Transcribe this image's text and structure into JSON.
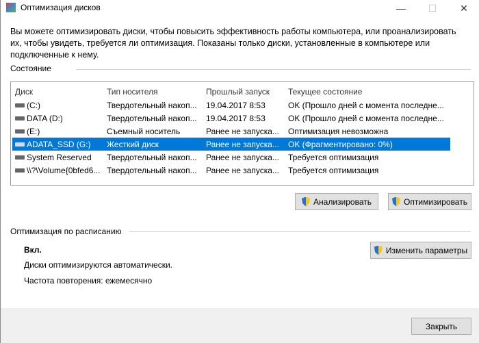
{
  "window": {
    "title": "Оптимизация дисков",
    "minimize": "—",
    "maximize": "☐",
    "close": "✕"
  },
  "description": "Вы можете оптимизировать диски, чтобы повысить эффективность работы  компьютера, или проанализировать их, чтобы увидеть, требуется ли оптимизация. Показаны только диски, установленные в компьютере или подключенные к нему.",
  "status_section": "Состояние",
  "columns": [
    "Диск",
    "Тип носителя",
    "Прошлый запуск",
    "Текущее состояние"
  ],
  "drives": [
    {
      "name": "(C:)",
      "type": "Твердотельный накоп...",
      "last_run": "19.04.2017 8:53",
      "status": "OK (Прошло дней с момента последне...",
      "icon": "system-drive-icon"
    },
    {
      "name": "DATA (D:)",
      "type": "Твердотельный накоп...",
      "last_run": "19.04.2017 8:53",
      "status": "OK (Прошло дней с момента последне...",
      "icon": "drive-icon"
    },
    {
      "name": "(E:)",
      "type": "Съемный носитель",
      "last_run": "Ранее не запуска...",
      "status": "Оптимизация невозможна",
      "icon": "usb-drive-icon"
    },
    {
      "name": "ADATA_SSD (G:)",
      "type": "Жесткий диск",
      "last_run": "Ранее не запуска...",
      "status": "OK (Фрагментировано: 0%)",
      "icon": "drive-icon",
      "selected": true
    },
    {
      "name": "System Reserved",
      "type": "Твердотельный накоп...",
      "last_run": "Ранее не запуска...",
      "status": "Требуется оптимизация",
      "icon": "drive-icon"
    },
    {
      "name": "\\\\?\\Volume{0bfed6...",
      "type": "Твердотельный накоп...",
      "last_run": "Ранее не запуска...",
      "status": "Требуется оптимизация",
      "icon": "drive-icon"
    }
  ],
  "buttons": {
    "analyze": "Анализировать",
    "optimize": "Оптимизировать",
    "change_settings": "Изменить параметры",
    "close": "Закрыть"
  },
  "schedule": {
    "section": "Оптимизация по расписанию",
    "state": "Вкл.",
    "auto": "Диски оптимизируются автоматически.",
    "frequency": "Частота повторения: ежемесячно"
  }
}
